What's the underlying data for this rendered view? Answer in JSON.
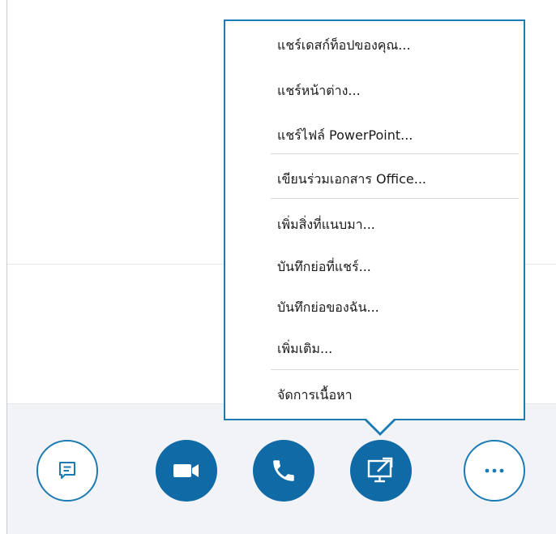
{
  "share_menu": {
    "items": [
      {
        "label": "แชร์เดสก์ท็อปของคุณ..."
      },
      {
        "label": "แชร์หน้าต่าง..."
      },
      {
        "label": "แชร์ไฟล์ PowerPoint..."
      },
      {
        "label": "เขียนร่วมเอกสาร Office..."
      },
      {
        "label": "เพิ่มสิ่งที่แนบมา..."
      },
      {
        "label": "บันทึกย่อที่แชร์..."
      },
      {
        "label": "บันทึกย่อของฉัน..."
      },
      {
        "label": "เพิ่มเติม..."
      },
      {
        "label": "จัดการเนื้อหา"
      }
    ]
  },
  "toolbar": {
    "buttons": [
      {
        "icon": "chat-bubble-icon"
      },
      {
        "icon": "video-camera-icon"
      },
      {
        "icon": "phone-icon"
      },
      {
        "icon": "share-screen-icon"
      },
      {
        "icon": "ellipsis-icon"
      }
    ]
  },
  "colors": {
    "accent": "#0f6aa5",
    "border": "#1b7bb5",
    "toolbar_background": "#f2f3f6"
  }
}
